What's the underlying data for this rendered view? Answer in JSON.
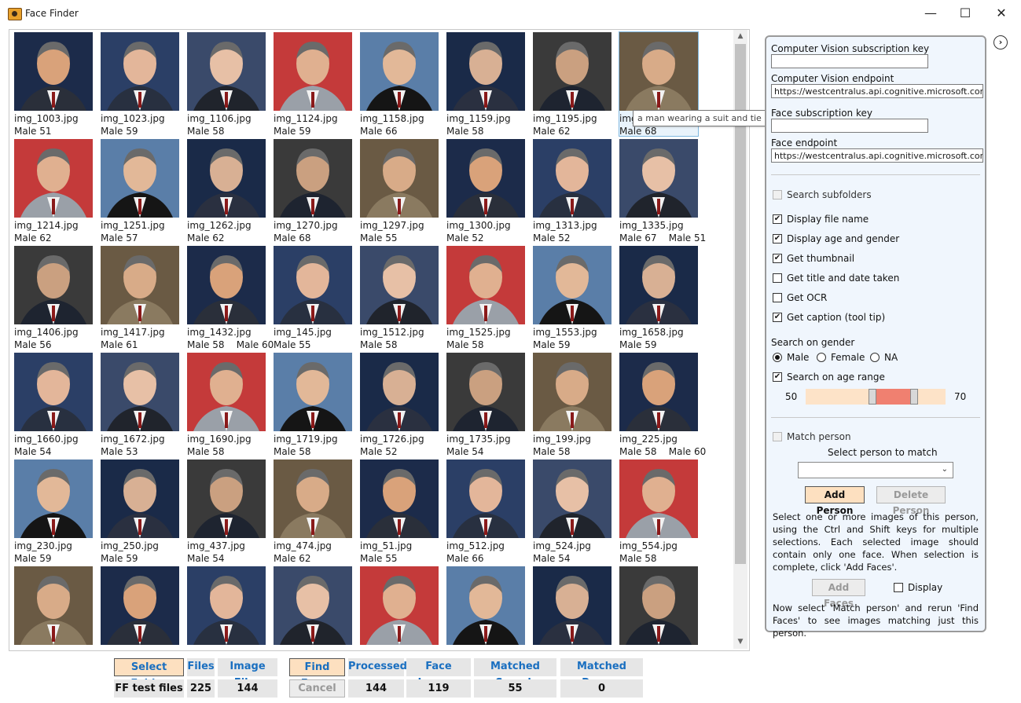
{
  "window": {
    "title": "Face Finder",
    "minimize": "—",
    "maximize": "☐",
    "close": "✕"
  },
  "tooltip": "a man wearing a suit and tie",
  "images": [
    {
      "name": "img_1003.jpg",
      "age": "Male 51"
    },
    {
      "name": "img_1023.jpg",
      "age": "Male 59"
    },
    {
      "name": "img_1106.jpg",
      "age": "Male 58"
    },
    {
      "name": "img_1124.jpg",
      "age": "Male 59"
    },
    {
      "name": "img_1158.jpg",
      "age": "Male 66"
    },
    {
      "name": "img_1159.jpg",
      "age": "Male 58"
    },
    {
      "name": "img_1195.jpg",
      "age": "Male 62"
    },
    {
      "name": "img_1203.jpg",
      "age": "Male 68"
    },
    {
      "name": "img_1214.jpg",
      "age": "Male 62"
    },
    {
      "name": "img_1251.jpg",
      "age": "Male 57"
    },
    {
      "name": "img_1262.jpg",
      "age": "Male 62"
    },
    {
      "name": "img_1270.jpg",
      "age": "Male 68"
    },
    {
      "name": "img_1297.jpg",
      "age": "Male 55"
    },
    {
      "name": "img_1300.jpg",
      "age": "Male 52"
    },
    {
      "name": "img_1313.jpg",
      "age": "Male 52"
    },
    {
      "name": "img_1335.jpg",
      "age": "Male 67    Male 51"
    },
    {
      "name": "img_1406.jpg",
      "age": "Male 56"
    },
    {
      "name": "img_1417.jpg",
      "age": "Male 61"
    },
    {
      "name": "img_1432.jpg",
      "age": "Male 58    Male 60"
    },
    {
      "name": "img_145.jpg",
      "age": "Male 55"
    },
    {
      "name": "img_1512.jpg",
      "age": "Male 58"
    },
    {
      "name": "img_1525.jpg",
      "age": "Male 58"
    },
    {
      "name": "img_1553.jpg",
      "age": "Male 59"
    },
    {
      "name": "img_1658.jpg",
      "age": "Male 59"
    },
    {
      "name": "img_1660.jpg",
      "age": "Male 54"
    },
    {
      "name": "img_1672.jpg",
      "age": "Male 53"
    },
    {
      "name": "img_1690.jpg",
      "age": "Male 58"
    },
    {
      "name": "img_1719.jpg",
      "age": "Male 58"
    },
    {
      "name": "img_1726.jpg",
      "age": "Male 52"
    },
    {
      "name": "img_1735.jpg",
      "age": "Male 54"
    },
    {
      "name": "img_199.jpg",
      "age": "Male 58"
    },
    {
      "name": "img_225.jpg",
      "age": "Male 58    Male 60"
    },
    {
      "name": "img_230.jpg",
      "age": "Male 59"
    },
    {
      "name": "img_250.jpg",
      "age": "Male 59"
    },
    {
      "name": "img_437.jpg",
      "age": "Male 54"
    },
    {
      "name": "img_474.jpg",
      "age": "Male 62"
    },
    {
      "name": "img_51.jpg",
      "age": "Male 55"
    },
    {
      "name": "img_512.jpg",
      "age": "Male 66"
    },
    {
      "name": "img_524.jpg",
      "age": "Male 54"
    },
    {
      "name": "img_554.jpg",
      "age": "Male 58"
    },
    {
      "name": "",
      "age": ""
    },
    {
      "name": "",
      "age": ""
    },
    {
      "name": "",
      "age": ""
    },
    {
      "name": "",
      "age": ""
    },
    {
      "name": "",
      "age": ""
    },
    {
      "name": "",
      "age": ""
    },
    {
      "name": "",
      "age": ""
    },
    {
      "name": "",
      "age": ""
    }
  ],
  "settings": {
    "cv_key_label": "Computer Vision subscription key",
    "cv_key_value": "",
    "cv_endpoint_label": "Computer Vision endpoint",
    "cv_endpoint_value": "https://westcentralus.api.cognitive.microsoft.com",
    "face_key_label": "Face subscription key",
    "face_key_value": "",
    "face_endpoint_label": "Face endpoint",
    "face_endpoint_value": "https://westcentralus.api.cognitive.microsoft.com",
    "search_subfolders": "Search subfolders",
    "display_file_name": "Display file name",
    "display_age_gender": "Display age and gender",
    "get_thumbnail": "Get thumbnail",
    "get_title_date": "Get title and date taken",
    "get_ocr": "Get OCR",
    "get_caption": "Get caption (tool tip)",
    "search_gender_label": "Search on gender",
    "gender_male": "Male",
    "gender_female": "Female",
    "gender_na": "NA",
    "search_age_range": "Search on age range",
    "age_min": "50",
    "age_max": "70",
    "match_person": "Match person",
    "select_person_label": "Select person to match",
    "select_person_value": "",
    "add_person": "Add Person",
    "delete_person": "Delete Person",
    "help_text_1": "Select one or more images of this person, using the Ctrl and Shift keys for multiple selections. Each selected image should contain only one face. When selection is complete, click 'Add Faces'.",
    "add_faces": "Add Faces",
    "display": "Display",
    "help_text_2": "Now select 'Match person' and rerun 'Find Faces' to see images matching just this person."
  },
  "bottom": {
    "select_folder": "Select Folder",
    "folder_value": "FF test files",
    "files_label": "Files",
    "files_value": "225",
    "image_files_label": "Image Files",
    "image_files_value": "144",
    "find_faces": "Find Faces",
    "cancel": "Cancel",
    "processed_label": "Processed",
    "processed_value": "144",
    "face_images_label": "Face Images",
    "face_images_value": "119",
    "matched_search_label": "Matched Search",
    "matched_search_value": "55",
    "matched_person_label": "Matched Person",
    "matched_person_value": "0"
  },
  "colors": {
    "accent_blue": "#1a6fc0",
    "button_peach": "#fde0c0",
    "panel_bg": "#f0f6fd",
    "range_fill": "#f08070",
    "range_track": "#fde3c8"
  }
}
